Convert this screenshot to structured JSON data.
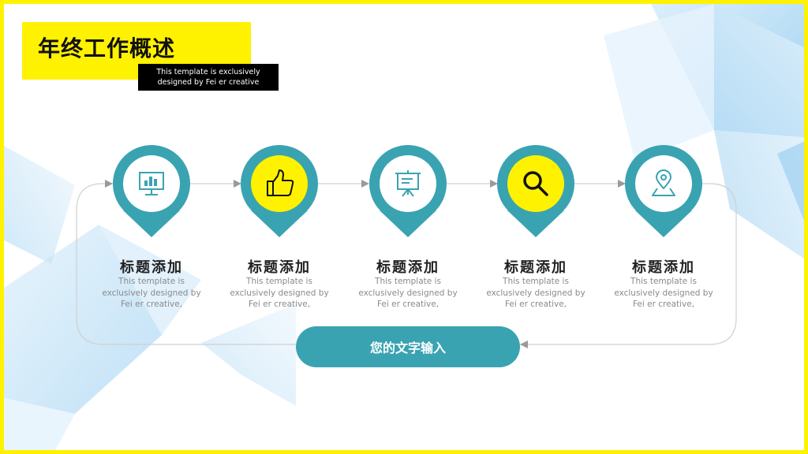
{
  "slide": {
    "title": "年终工作概述",
    "subtitle_line1": "This template is exclusively",
    "subtitle_line2": "designed by Fei er creative"
  },
  "colors": {
    "accent_yellow": "#fff200",
    "teal": "#3aa3b1",
    "light_blue": "#bfe0f5"
  },
  "items": [
    {
      "title": "标题添加",
      "desc1": "This template is",
      "desc2": "exclusively designed by",
      "desc3": "Fei er creative,",
      "icon": "presentation-chart-icon",
      "ring": "white"
    },
    {
      "title": "标题添加",
      "desc1": "This template is",
      "desc2": "exclusively designed by",
      "desc3": "Fei er creative,",
      "icon": "thumbs-up-icon",
      "ring": "yellow"
    },
    {
      "title": "标题添加",
      "desc1": "This template is",
      "desc2": "exclusively designed by",
      "desc3": "Fei er creative,",
      "icon": "easel-board-icon",
      "ring": "white"
    },
    {
      "title": "标题添加",
      "desc1": "This template is",
      "desc2": "exclusively designed by",
      "desc3": "Fei er creative,",
      "icon": "search-icon",
      "ring": "yellow"
    },
    {
      "title": "标题添加",
      "desc1": "This template is",
      "desc2": "exclusively designed by",
      "desc3": "Fei er creative,",
      "icon": "location-pin-icon",
      "ring": "white"
    }
  ],
  "pill_label": "您的文字输入"
}
